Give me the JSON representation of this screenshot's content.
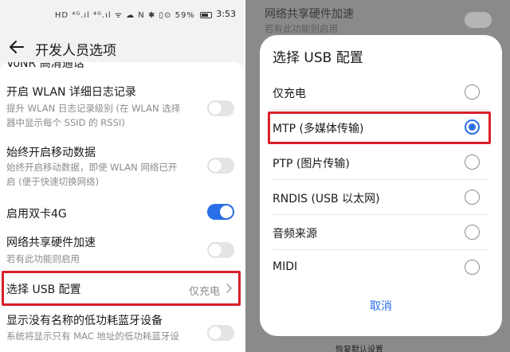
{
  "status_bar": {
    "icons_text": "HD ⁴ᴳ.ıl ⁴ᴳ.ıl ᯤ ☁ N ✱ ▯⊙ 59%",
    "time": "3:53"
  },
  "header": {
    "title": "开发人员选项"
  },
  "settings": {
    "partial_top": "VoNR 高清通话",
    "rows": [
      {
        "title": "开启 WLAN 详细日志记录",
        "sub1": "提升 WLAN 日志记录级别 (在 WLAN 选择",
        "sub2": "器中显示每个 SSID 的 RSSI)"
      },
      {
        "title": "始终开启移动数据",
        "sub1": "始终开启移动数据，即使 WLAN 网络已开",
        "sub2": "启 (便于快速切换网络)"
      },
      {
        "title": "启用双卡4G"
      },
      {
        "title": "网络共享硬件加速",
        "sub1": "若有此功能则启用"
      },
      {
        "title": "选择 USB 配置",
        "value": "仅充电"
      },
      {
        "title": "显示没有名称的低功耗蓝牙设备",
        "sub1": "系统将显示只有 MAC 地址的低功耗蓝牙设"
      }
    ]
  },
  "background": {
    "row_title": "网络共享硬件加速",
    "row_sub": "若有此功能则启用",
    "bottom_text": "恢复默认设置"
  },
  "dialog": {
    "title": "选择 USB 配置",
    "options": [
      {
        "label": "仅充电"
      },
      {
        "label": "MTP (多媒体传输)"
      },
      {
        "label": "PTP (图片传输)"
      },
      {
        "label": "RNDIS (USB 以太网)"
      },
      {
        "label": "音频来源"
      },
      {
        "label": "MIDI"
      }
    ],
    "selected_option": "MTP (多媒体传输)",
    "cancel_label": "取消"
  },
  "colors": {
    "accent": "#2a6ee8",
    "highlight": "#d8202a",
    "toggle_off": "#e4e4e4"
  }
}
